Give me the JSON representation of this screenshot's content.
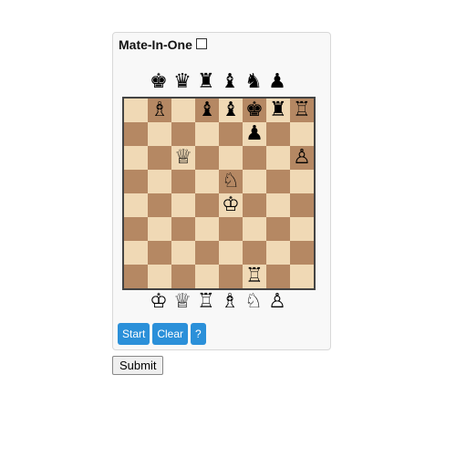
{
  "header": {
    "title": "Mate-In-One"
  },
  "palettes": {
    "black": [
      {
        "name": "black-king-icon",
        "glyph": "♚"
      },
      {
        "name": "black-queen-icon",
        "glyph": "♛"
      },
      {
        "name": "black-rook-icon",
        "glyph": "♜"
      },
      {
        "name": "black-bishop-icon",
        "glyph": "♝"
      },
      {
        "name": "black-knight-icon",
        "glyph": "♞"
      },
      {
        "name": "black-pawn-icon",
        "glyph": "♟"
      }
    ],
    "white": [
      {
        "name": "white-king-icon",
        "glyph": "♔"
      },
      {
        "name": "white-queen-icon",
        "glyph": "♕"
      },
      {
        "name": "white-rook-icon",
        "glyph": "♖"
      },
      {
        "name": "white-bishop-icon",
        "glyph": "♗"
      },
      {
        "name": "white-knight-icon",
        "glyph": "♘"
      },
      {
        "name": "white-pawn-icon",
        "glyph": "♙"
      }
    ]
  },
  "board": {
    "light_color": "#f0d9b5",
    "dark_color": "#b58863",
    "pieces": [
      {
        "square": "b8",
        "glyph": "♗",
        "name": "white-bishop-icon"
      },
      {
        "square": "d8",
        "glyph": "♝",
        "name": "black-bishop-icon"
      },
      {
        "square": "e8",
        "glyph": "♝",
        "name": "black-bishop-icon"
      },
      {
        "square": "f8",
        "glyph": "♚",
        "name": "black-king-icon"
      },
      {
        "square": "g8",
        "glyph": "♜",
        "name": "black-rook-icon"
      },
      {
        "square": "h8",
        "glyph": "♖",
        "name": "white-rook-icon"
      },
      {
        "square": "f7",
        "glyph": "♟",
        "name": "black-pawn-icon"
      },
      {
        "square": "c6",
        "glyph": "♕",
        "name": "white-queen-icon"
      },
      {
        "square": "h6",
        "glyph": "♙",
        "name": "white-pawn-icon"
      },
      {
        "square": "e5",
        "glyph": "♘",
        "name": "white-knight-icon"
      },
      {
        "square": "e4",
        "glyph": "♔",
        "name": "white-king-icon"
      },
      {
        "square": "f1",
        "glyph": "♖",
        "name": "white-rook-icon"
      }
    ]
  },
  "controls": {
    "start_label": "Start",
    "clear_label": "Clear",
    "help_label": "?",
    "button_color": "#2b90d9"
  },
  "form": {
    "submit_label": "Submit"
  }
}
